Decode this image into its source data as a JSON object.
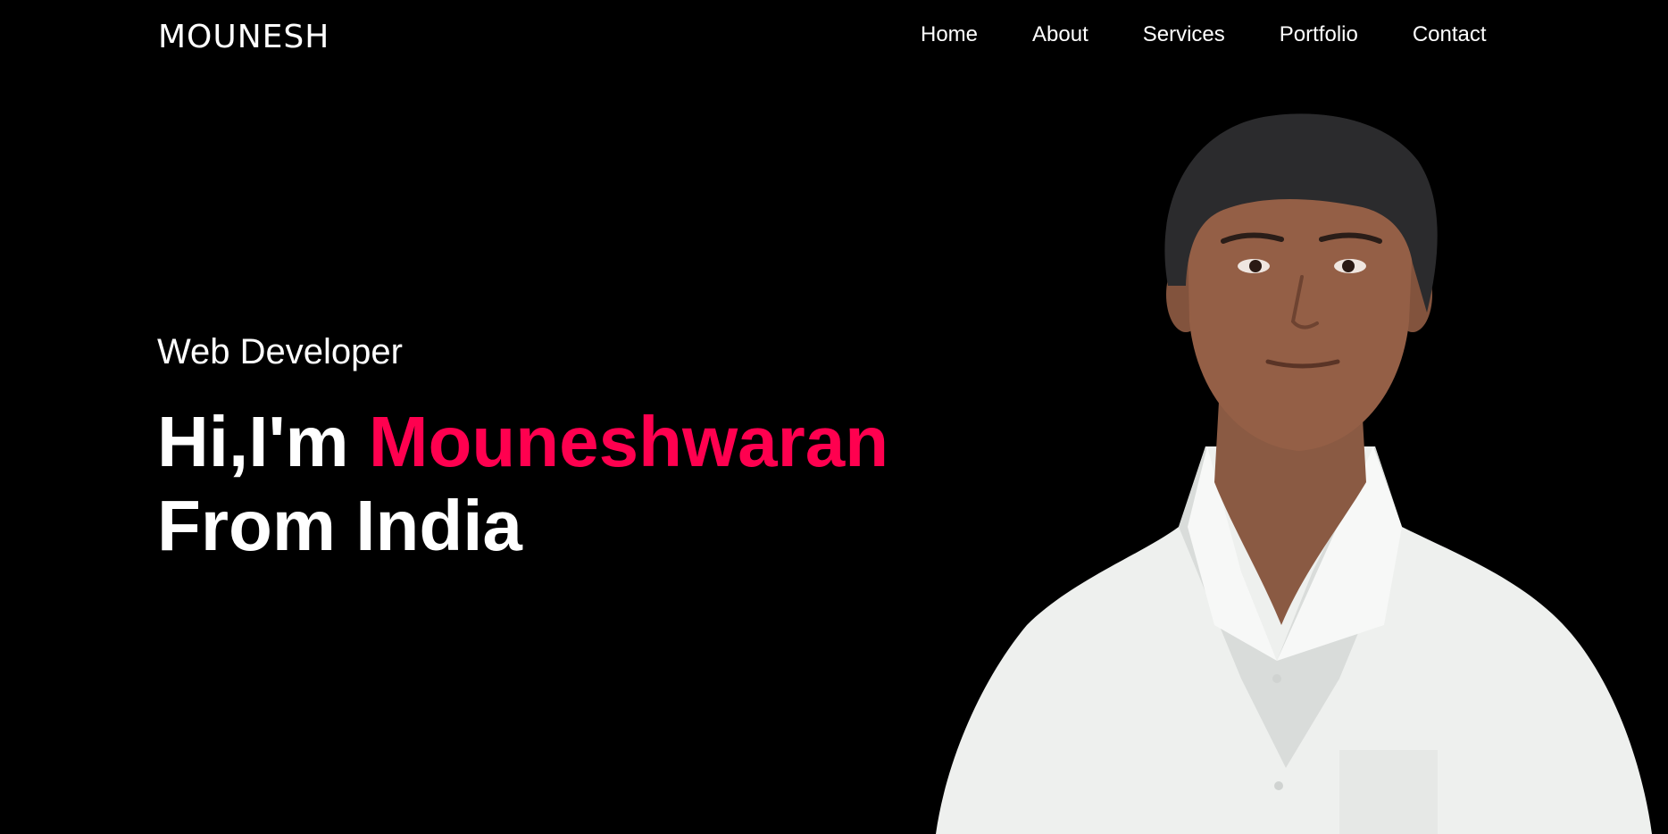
{
  "header": {
    "logo_text": "MOUNESH",
    "nav": [
      {
        "label": "Home"
      },
      {
        "label": "About"
      },
      {
        "label": "Services"
      },
      {
        "label": "Portfolio"
      },
      {
        "label": "Contact"
      }
    ]
  },
  "hero": {
    "subtitle": "Web Developer",
    "greeting": "Hi,I'm ",
    "name": "Mouneshwaran",
    "origin": "From India"
  },
  "colors": {
    "background": "#000000",
    "text": "#ffffff",
    "accent": "#ff004f"
  },
  "icons": {
    "portrait": "profile-photo"
  }
}
